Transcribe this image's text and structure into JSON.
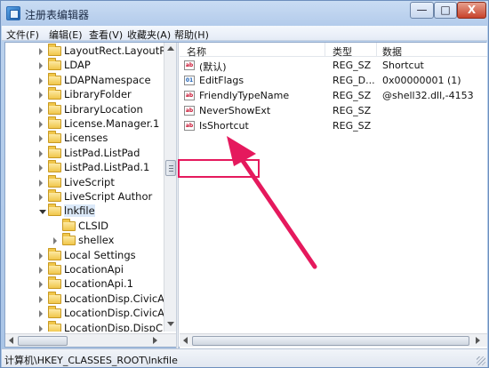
{
  "window": {
    "title": "注册表编辑器",
    "minimize": "—",
    "maximize": "□",
    "close": "X"
  },
  "menu": [
    "文件(F)",
    "编辑(E)",
    "查看(V)",
    "收藏夹(A)",
    "帮助(H)"
  ],
  "tree": {
    "items": [
      {
        "label": "LayoutRect.LayoutRect",
        "state": "collapsed"
      },
      {
        "label": "LDAP",
        "state": "collapsed"
      },
      {
        "label": "LDAPNamespace",
        "state": "collapsed"
      },
      {
        "label": "LibraryFolder",
        "state": "collapsed"
      },
      {
        "label": "LibraryLocation",
        "state": "collapsed"
      },
      {
        "label": "License.Manager.1",
        "state": "collapsed"
      },
      {
        "label": "Licenses",
        "state": "collapsed"
      },
      {
        "label": "ListPad.ListPad",
        "state": "collapsed"
      },
      {
        "label": "ListPad.ListPad.1",
        "state": "collapsed"
      },
      {
        "label": "LiveScript",
        "state": "collapsed"
      },
      {
        "label": "LiveScript Author",
        "state": "collapsed"
      },
      {
        "label": "lnkfile",
        "state": "expanded"
      },
      {
        "label": "CLSID",
        "state": "leaf"
      },
      {
        "label": "shellex",
        "state": "collapsed"
      },
      {
        "label": "Local Settings",
        "state": "collapsed"
      },
      {
        "label": "LocationApi",
        "state": "collapsed"
      },
      {
        "label": "LocationApi.1",
        "state": "collapsed"
      },
      {
        "label": "LocationDisp.CivicAdd",
        "state": "collapsed"
      },
      {
        "label": "LocationDisp.CivicAdd",
        "state": "collapsed"
      },
      {
        "label": "LocationDisp.DispCivic",
        "state": "collapsed"
      }
    ]
  },
  "list": {
    "headers": {
      "name": "名称",
      "type": "类型",
      "data": "数据"
    },
    "rows": [
      {
        "icon": "string-value-icon",
        "name": "(默认)",
        "type": "REG_SZ",
        "data": "Shortcut"
      },
      {
        "icon": "binary-value-icon",
        "name": "EditFlags",
        "type": "REG_D...",
        "data": "0x00000001 (1)"
      },
      {
        "icon": "string-value-icon",
        "name": "FriendlyTypeName",
        "type": "REG_SZ",
        "data": "@shell32.dll,-4153"
      },
      {
        "icon": "string-value-icon",
        "name": "NeverShowExt",
        "type": "REG_SZ",
        "data": ""
      },
      {
        "icon": "string-value-icon",
        "name": "IsShortcut",
        "type": "REG_SZ",
        "data": ""
      }
    ]
  },
  "status": "计算机\\HKEY_CLASSES_ROOT\\lnkfile",
  "colors": {
    "highlight": "#e5195d",
    "selection": "#dbe9f9"
  }
}
